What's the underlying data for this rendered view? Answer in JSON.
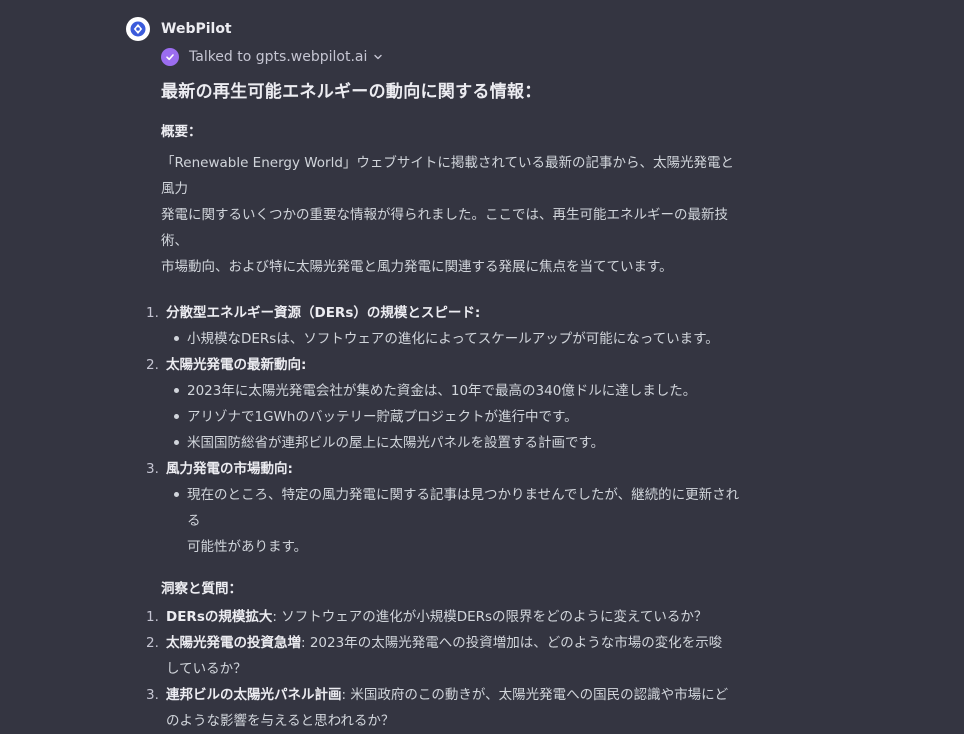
{
  "message": {
    "author": "WebPilot",
    "tool_status": "Talked to gpts.webpilot.ai",
    "title": "最新の再生可能エネルギーの動向に関する情報：",
    "overview_heading": "概要：",
    "overview_lines": [
      "「Renewable Energy World」ウェブサイトに掲載されている最新の記事から、太陽光発電と風力",
      "発電に関するいくつかの重要な情報が得られました。ここでは、再生可能エネルギーの最新技術、",
      "市場動向、および特に太陽光発電と風力発電に関連する発展に焦点を当てています。"
    ],
    "sections": [
      {
        "num": "1.",
        "label": "分散型エネルギー資源（DERs）の規模とスピード:",
        "bullets": [
          [
            "小規模なDERsは、ソフトウェアの進化によってスケールアップが可能になっています。"
          ]
        ]
      },
      {
        "num": "2.",
        "label": "太陽光発電の最新動向:",
        "bullets": [
          [
            "2023年に太陽光発電会社が集めた資金は、10年で最高の340億ドルに達しました。"
          ],
          [
            "アリゾナで1GWhのバッテリー貯蔵プロジェクトが進行中です。"
          ],
          [
            "米国国防総省が連邦ビルの屋上に太陽光パネルを設置する計画です。"
          ]
        ]
      },
      {
        "num": "3.",
        "label": "風力発電の市場動向:",
        "bullets": [
          [
            "現在のところ、特定の風力発電に関する記事は見つかりませんでしたが、継続的に更新される",
            "可能性があります。"
          ]
        ]
      }
    ],
    "insights_heading": "洞察と質問：",
    "questions": [
      {
        "num": "1.",
        "bold": "DERsの規模拡大",
        "lines": [
          ": ソフトウェアの進化が小規模DERsの限界をどのように変えているか？"
        ]
      },
      {
        "num": "2.",
        "bold": "太陽光発電の投資急増",
        "lines": [
          ": 2023年の太陽光発電への投資増加は、どのような市場の変化を示唆",
          "しているか？"
        ]
      },
      {
        "num": "3.",
        "bold": "連邦ビルの太陽光パネル計画",
        "lines": [
          ": 米国政府のこの動きが、太陽光発電への国民の認識や市場にど",
          "のような影響を与えると思われるか？"
        ]
      }
    ]
  },
  "colors": {
    "background": "#343541",
    "text": "#ececf1",
    "muted": "#d1d5db",
    "accent": "#9b6df0",
    "avatar_logo": "#3b5bdb"
  },
  "icons": {
    "avatar": "webpilot-logo-icon",
    "tool_check": "check-icon",
    "tool_expand": "chevron-down-icon"
  }
}
